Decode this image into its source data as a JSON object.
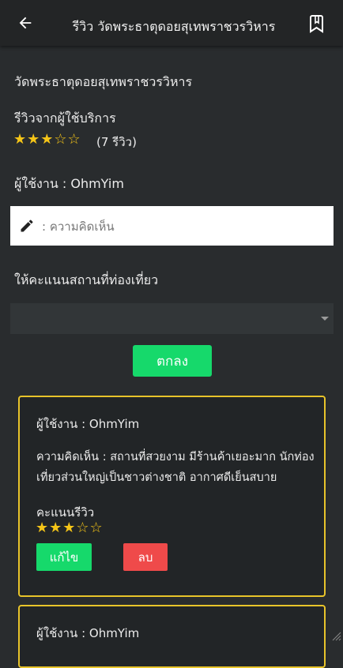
{
  "appbar": {
    "title": "รีวิว วัดพระธาตุดอยสุเทพราชวรวิหาร",
    "back_icon": "arrow-left-icon",
    "bookmark_icon": "bookmark-icon"
  },
  "place": {
    "name": "วัดพระธาตุดอยสุเทพราชวรวิหาร",
    "reviews_heading": "รีวิวจากผู้ใช้บริการ",
    "average_stars": "★★★☆☆",
    "average_rating": 3,
    "max_rating": 5,
    "review_count": "(7 รีวิว)"
  },
  "form": {
    "current_user": "ผู้ใช้งาน : OhmYim",
    "comment_placeholder": ": ความคิดเห็น",
    "comment_value": "",
    "rate_label": "ให้คะแนนสถานที่ท่องเที่ยว",
    "rating_selected": "",
    "submit_label": "ตกลง"
  },
  "reviews": [
    {
      "user": "ผู้ใช้งาน : OhmYim",
      "comment": "ความคิดเห็น : สถานที่สวยงาม มีร้านค้าเยอะมาก นักท่องเที่ยวส่วนใหญ่เป็นชาวต่างชาติ อากาศดีเย็นสบาย",
      "score_label": "คะแนนรีวิว",
      "stars": "★★★☆☆",
      "rating": 3,
      "edit_label": "แก้ไข",
      "delete_label": "ลบ"
    },
    {
      "user": "ผู้ใช้งาน : OhmYim"
    }
  ],
  "colors": {
    "background": "#292c2e",
    "appbar": "#232526",
    "accent_green": "#16d96b",
    "danger_red": "#ef4a4a",
    "card_border": "#e8c42a",
    "star": "#f5c518"
  }
}
